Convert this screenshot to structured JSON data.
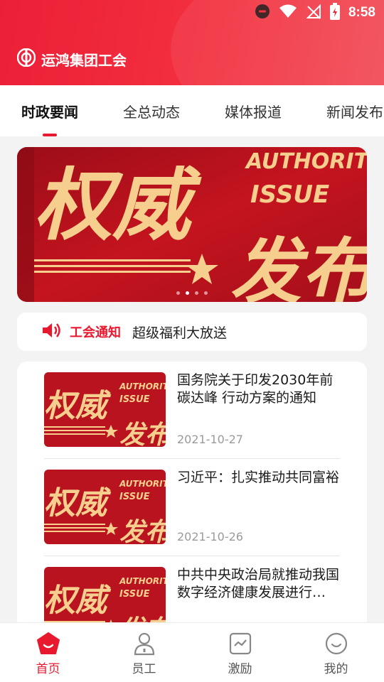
{
  "status_bar": {
    "time": "8:58"
  },
  "header": {
    "title": "运鸿集团工会"
  },
  "tabs": [
    {
      "label": "时政要闻",
      "active": true
    },
    {
      "label": "全总动态",
      "active": false
    },
    {
      "label": "媒体报道",
      "active": false
    },
    {
      "label": "新闻发布",
      "active": false
    }
  ],
  "banner": {
    "cn_line1": "权威",
    "cn_line2": "发布",
    "en_line1": "AUTHORITY",
    "en_line2": "ISSUE",
    "carousel_count": 4,
    "carousel_active_index": 1
  },
  "notice": {
    "label": "工会通知",
    "text": "超级福利大放送"
  },
  "news": [
    {
      "title": "国务院关于印发2030年前碳达峰 行动方案的通知",
      "date": "2021-10-27",
      "thumb": {
        "cn1": "权威",
        "cn2": "发布",
        "en1": "AUTHORIT",
        "en2": "ISSUE"
      }
    },
    {
      "title": "习近平：扎实推动共同富裕",
      "date": "2021-10-26",
      "thumb": {
        "cn1": "权威",
        "cn2": "发布",
        "en1": "AUTHORIT",
        "en2": "ISSUE"
      }
    },
    {
      "title": "中共中央政治局就推动我国数字经济健康发展进行集体学习",
      "date": "",
      "thumb": {
        "cn1": "权威",
        "cn2": "发布",
        "en1": "AUTHORIT",
        "en2": "ISSUE"
      }
    }
  ],
  "bottom_nav": [
    {
      "label": "首页",
      "icon": "home-icon",
      "active": true
    },
    {
      "label": "员工",
      "icon": "user-icon",
      "active": false
    },
    {
      "label": "激励",
      "icon": "chart-icon",
      "active": false
    },
    {
      "label": "我的",
      "icon": "smile-icon",
      "active": false
    }
  ],
  "colors": {
    "brand": "#e8192f",
    "banner_text": "#f6cf8e",
    "banner_bg": "#b3121f"
  }
}
